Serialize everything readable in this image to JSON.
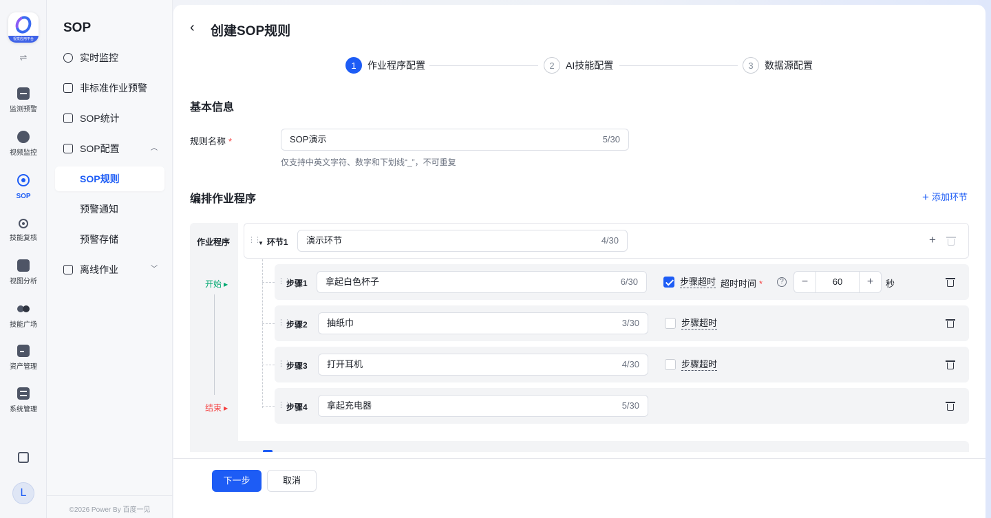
{
  "rail": {
    "logo_caption": "视觉应用平台",
    "items": [
      {
        "label": "监测预警",
        "icon": "chart-monitor-icon"
      },
      {
        "label": "视频监控",
        "icon": "camera-icon"
      },
      {
        "label": "SOP",
        "icon": "sop-icon"
      },
      {
        "label": "技能复核",
        "icon": "target-icon"
      },
      {
        "label": "视图分析",
        "icon": "image-analysis-icon"
      },
      {
        "label": "技能广场",
        "icon": "skill-square-icon"
      },
      {
        "label": "资产管理",
        "icon": "asset-icon"
      },
      {
        "label": "系统管理",
        "icon": "system-icon"
      }
    ],
    "avatar_letter": "L"
  },
  "sidebar": {
    "title": "SOP",
    "items": [
      {
        "label": "实时监控"
      },
      {
        "label": "非标准作业预警"
      },
      {
        "label": "SOP统计"
      },
      {
        "label": "SOP配置"
      },
      {
        "label": "SOP规则"
      },
      {
        "label": "预警通知"
      },
      {
        "label": "预警存储"
      },
      {
        "label": "离线作业"
      }
    ],
    "footer": "©2026 Power By 百度一见"
  },
  "page": {
    "title": "创建SOP规则",
    "steps": [
      {
        "num": "1",
        "label": "作业程序配置"
      },
      {
        "num": "2",
        "label": "AI技能配置"
      },
      {
        "num": "3",
        "label": "数据源配置"
      }
    ]
  },
  "basic": {
    "section_title": "基本信息",
    "name_label": "规则名称",
    "name_value": "SOP演示",
    "name_count": "5/30",
    "name_hint": "仅支持中英文字符、数字和下划线“_”，不可重复"
  },
  "process": {
    "section_title": "编排作业程序",
    "add_segment": "添加环节",
    "side_title": "作业程序",
    "start": "开始",
    "end": "结束",
    "segment": {
      "label": "环节1",
      "value": "演示环节",
      "count": "4/30"
    },
    "steps": [
      {
        "label": "步骤1",
        "value": "拿起白色杯子",
        "count": "6/30",
        "timeout_label": "步骤超时",
        "checked": true
      },
      {
        "label": "步骤2",
        "value": "抽纸巾",
        "count": "3/30",
        "timeout_label": "步骤超时",
        "checked": false
      },
      {
        "label": "步骤3",
        "value": "打开耳机",
        "count": "4/30",
        "timeout_label": "步骤超时",
        "checked": false
      },
      {
        "label": "步骤4",
        "value": "拿起充电器",
        "count": "5/30"
      }
    ],
    "timeout_time_label": "超时时间",
    "timeout_value": "60",
    "timeout_unit": "秒"
  },
  "footer": {
    "next": "下一步",
    "cancel": "取消"
  },
  "colors": {
    "accent": "#1d5cf5",
    "start": "#00a870",
    "end": "#f53f3f"
  }
}
